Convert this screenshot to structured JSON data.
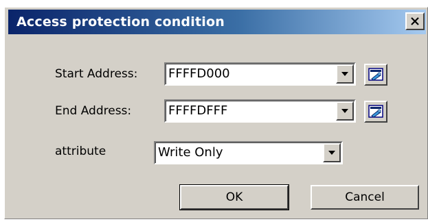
{
  "window": {
    "title": "Access protection condition",
    "close_icon": "close-icon"
  },
  "form": {
    "start_address": {
      "label": "Start Address:",
      "value": "FFFFD000",
      "browse_icon": "address-browse-icon"
    },
    "end_address": {
      "label": "End Address:",
      "value": "FFFFDFFF",
      "browse_icon": "address-browse-icon"
    },
    "attribute": {
      "label": "attribute",
      "value": "Write Only"
    }
  },
  "buttons": {
    "ok_label": "OK",
    "cancel_label": "Cancel"
  },
  "colors": {
    "title_gradient_start": "#0a246a",
    "title_gradient_end": "#a6caf0",
    "dialog_face": "#d4d0c8"
  }
}
